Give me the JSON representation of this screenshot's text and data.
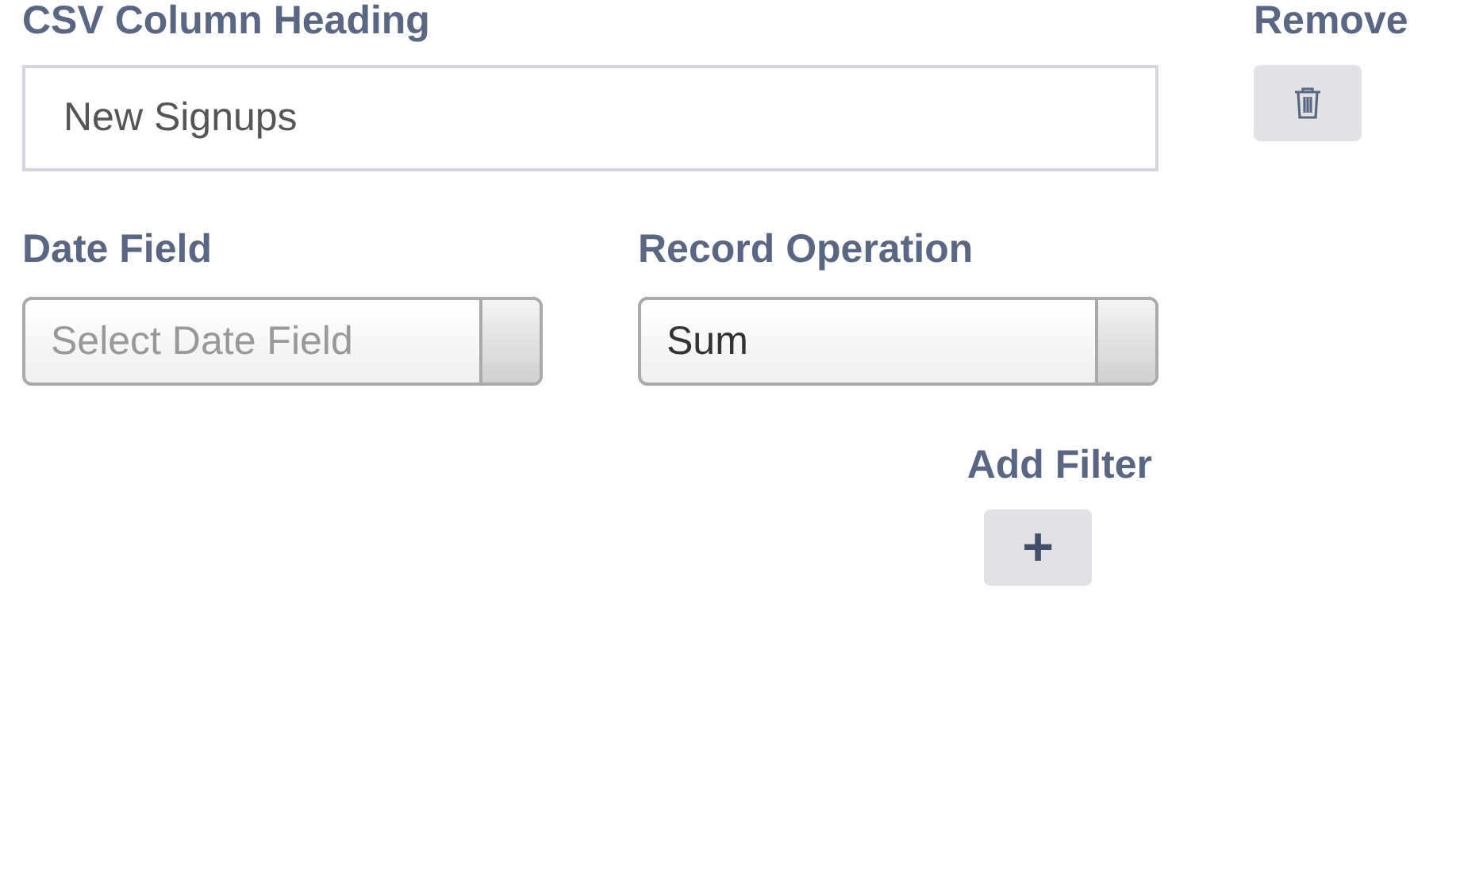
{
  "heading_field": {
    "label": "CSV Column Heading",
    "value": "New Signups"
  },
  "remove": {
    "label": "Remove"
  },
  "selects": [
    {
      "label": "Date Field",
      "placeholder": "Select Date Field"
    },
    {
      "label": "Record Operation",
      "value": "Sum"
    }
  ],
  "add_filter": {
    "label": "Add Filter",
    "button": "+"
  }
}
